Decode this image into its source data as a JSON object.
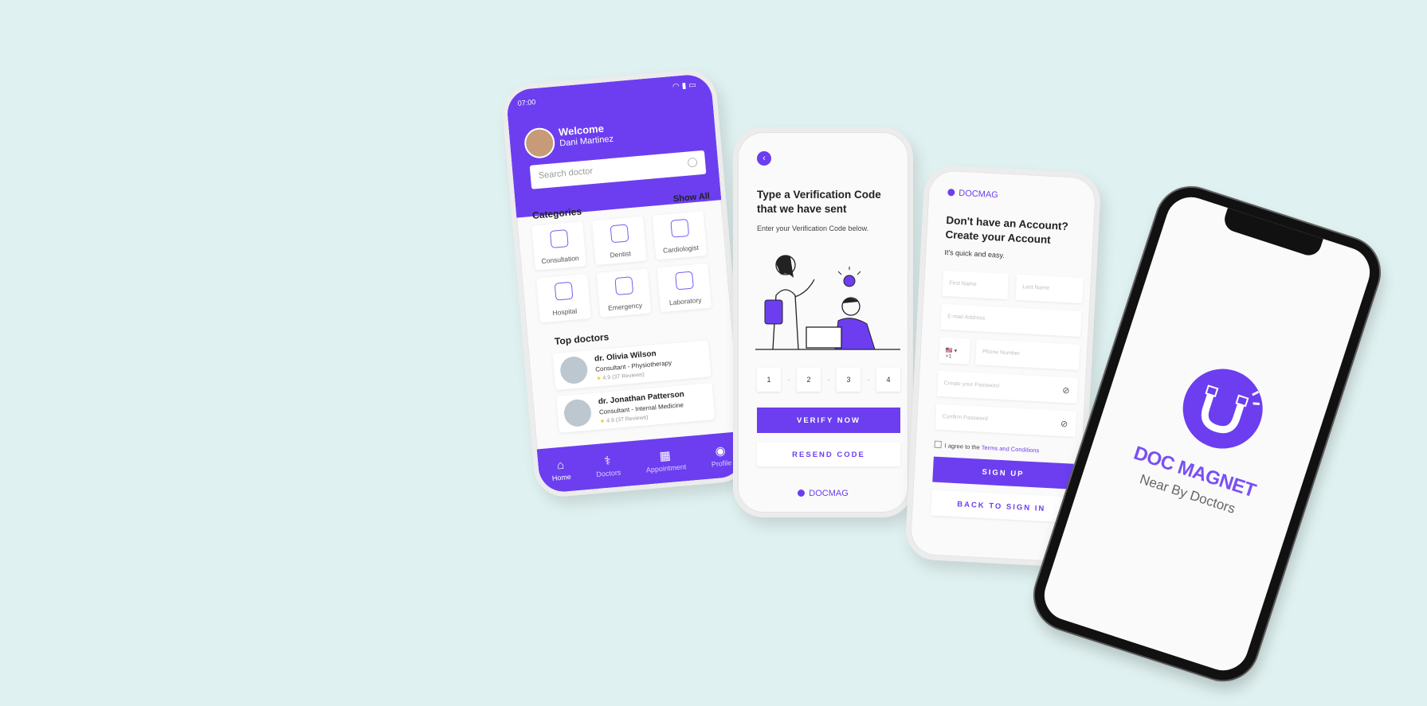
{
  "colors": {
    "accent": "#6c3ef0",
    "background": "#dff1f0",
    "star": "#f7c51e"
  },
  "home": {
    "status_time": "07:00",
    "greeting": "Welcome",
    "user_name": "Dani Martinez",
    "search_placeholder": "Search doctor",
    "categories_title": "Categories",
    "show_all": "Show All",
    "categories": [
      {
        "label": "Consultation",
        "icon": "consultation-icon"
      },
      {
        "label": "Dentist",
        "icon": "tooth-icon"
      },
      {
        "label": "Cardiologist",
        "icon": "heart-icon"
      },
      {
        "label": "Hospital",
        "icon": "hospital-icon"
      },
      {
        "label": "Emergency",
        "icon": "ambulance-icon"
      },
      {
        "label": "Laboratory",
        "icon": "lab-icon"
      }
    ],
    "top_doctors_title": "Top doctors",
    "doctors": [
      {
        "name": "dr. Olivia Wilson",
        "role": "Consultant - Physiotherapy",
        "rating": "4.9 (37 Reviews)"
      },
      {
        "name": "dr. Jonathan Patterson",
        "role": "Consultant - Internal Medicine",
        "rating": "4.9 (37 Reviews)"
      }
    ],
    "nav": [
      {
        "label": "Home",
        "icon": "home-icon"
      },
      {
        "label": "Doctors",
        "icon": "stethoscope-icon"
      },
      {
        "label": "Appointment",
        "icon": "calendar-icon"
      },
      {
        "label": "Profile",
        "icon": "profile-icon"
      }
    ]
  },
  "verify": {
    "title": "Type a Verification Code that we have sent",
    "subtitle": "Enter your Verification Code below.",
    "codes": [
      "1",
      "2",
      "3",
      "4"
    ],
    "verify_button": "VERIFY NOW",
    "resend_button": "RESEND CODE",
    "brand": "DOCMAG"
  },
  "signup": {
    "brand": "DOCMAG",
    "title": "Don't have an Account? Create your Account",
    "subtitle": "It's quick and easy.",
    "first_name_placeholder": "First Name",
    "last_name_placeholder": "Last Name",
    "email_placeholder": "E-mail Address",
    "country_code": "🇺🇸 ▾ +1",
    "phone_placeholder": "Phone Number",
    "password_placeholder": "Create your Password",
    "confirm_placeholder": "Confirm Password",
    "agree_text": "I agree to the ",
    "terms_link": "Terms and Conditions",
    "signup_button": "SIGN UP",
    "back_button": "BACK TO SIGN IN"
  },
  "splash": {
    "app_name": "DOC MAGNET",
    "tagline": "Near By Doctors"
  }
}
